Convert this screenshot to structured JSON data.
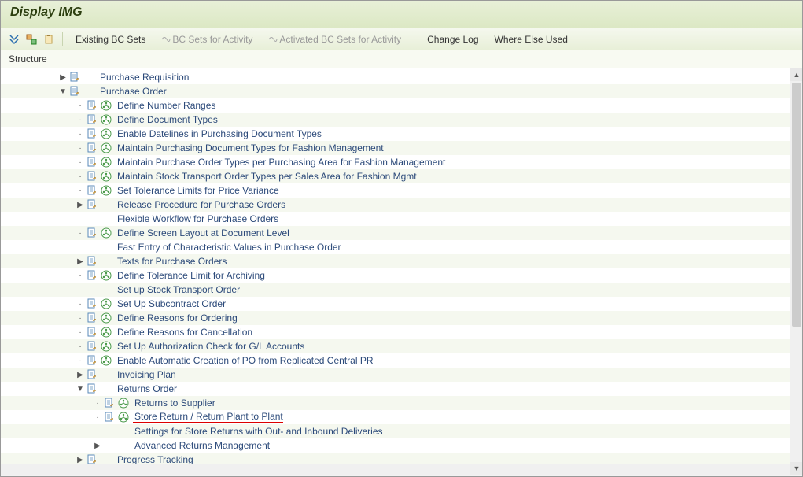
{
  "title": "Display IMG",
  "toolbar": {
    "existing_bc": "Existing BC Sets",
    "bc_activity": "BC Sets for Activity",
    "activated_bc": "Activated BC Sets for Activity",
    "change_log": "Change Log",
    "where_else": "Where Else Used"
  },
  "structure_label": "Structure",
  "tree": [
    {
      "indent": 1,
      "expander": "▶",
      "doc": true,
      "exec": false,
      "label": "Purchase Requisition"
    },
    {
      "indent": 1,
      "expander": "▼",
      "doc": true,
      "exec": false,
      "label": "Purchase Order"
    },
    {
      "indent": 2,
      "expander": "·",
      "doc": true,
      "exec": true,
      "label": "Define Number Ranges"
    },
    {
      "indent": 2,
      "expander": "·",
      "doc": true,
      "exec": true,
      "label": "Define Document Types"
    },
    {
      "indent": 2,
      "expander": "·",
      "doc": true,
      "exec": true,
      "label": "Enable Datelines in Purchasing Document Types"
    },
    {
      "indent": 2,
      "expander": "·",
      "doc": true,
      "exec": true,
      "label": "Maintain Purchasing Document Types for Fashion Management"
    },
    {
      "indent": 2,
      "expander": "·",
      "doc": true,
      "exec": true,
      "label": "Maintain Purchase Order Types per Purchasing Area for Fashion Management"
    },
    {
      "indent": 2,
      "expander": "·",
      "doc": true,
      "exec": true,
      "label": "Maintain Stock Transport Order Types per Sales Area for Fashion Mgmt"
    },
    {
      "indent": 2,
      "expander": "·",
      "doc": true,
      "exec": true,
      "label": "Set Tolerance Limits for Price Variance"
    },
    {
      "indent": 2,
      "expander": "▶",
      "doc": true,
      "exec": false,
      "label": "Release Procedure for Purchase Orders"
    },
    {
      "indent": 2,
      "expander": "",
      "doc": false,
      "exec": false,
      "label": "Flexible Workflow for Purchase Orders"
    },
    {
      "indent": 2,
      "expander": "·",
      "doc": true,
      "exec": true,
      "label": "Define Screen Layout at Document Level"
    },
    {
      "indent": 2,
      "expander": "",
      "doc": false,
      "exec": false,
      "label": "Fast Entry of Characteristic Values in Purchase Order"
    },
    {
      "indent": 2,
      "expander": "▶",
      "doc": true,
      "exec": false,
      "label": "Texts for Purchase Orders"
    },
    {
      "indent": 2,
      "expander": "·",
      "doc": true,
      "exec": true,
      "label": "Define Tolerance Limit for Archiving"
    },
    {
      "indent": 2,
      "expander": "",
      "doc": false,
      "exec": false,
      "label": "Set up Stock Transport Order"
    },
    {
      "indent": 2,
      "expander": "·",
      "doc": true,
      "exec": true,
      "label": "Set Up Subcontract Order"
    },
    {
      "indent": 2,
      "expander": "·",
      "doc": true,
      "exec": true,
      "label": "Define Reasons for Ordering"
    },
    {
      "indent": 2,
      "expander": "·",
      "doc": true,
      "exec": true,
      "label": "Define Reasons for Cancellation"
    },
    {
      "indent": 2,
      "expander": "·",
      "doc": true,
      "exec": true,
      "label": "Set Up Authorization Check for G/L Accounts"
    },
    {
      "indent": 2,
      "expander": "·",
      "doc": true,
      "exec": true,
      "label": "Enable Automatic Creation of PO from Replicated Central PR"
    },
    {
      "indent": 2,
      "expander": "▶",
      "doc": true,
      "exec": false,
      "label": "Invoicing Plan"
    },
    {
      "indent": 2,
      "expander": "▼",
      "doc": true,
      "exec": false,
      "label": "Returns Order"
    },
    {
      "indent": 3,
      "expander": "·",
      "doc": true,
      "exec": true,
      "label": "Returns to Supplier"
    },
    {
      "indent": 3,
      "expander": "·",
      "doc": true,
      "exec": true,
      "label": "Store Return / Return Plant to Plant",
      "highlight": true
    },
    {
      "indent": 3,
      "expander": "",
      "doc": false,
      "exec": false,
      "label": "Settings for Store Returns with Out- and Inbound Deliveries"
    },
    {
      "indent": 3,
      "expander": "▶",
      "doc": false,
      "exec": false,
      "label": "Advanced Returns Management"
    },
    {
      "indent": 2,
      "expander": "▶",
      "doc": true,
      "exec": false,
      "label": "Progress Tracking"
    }
  ]
}
